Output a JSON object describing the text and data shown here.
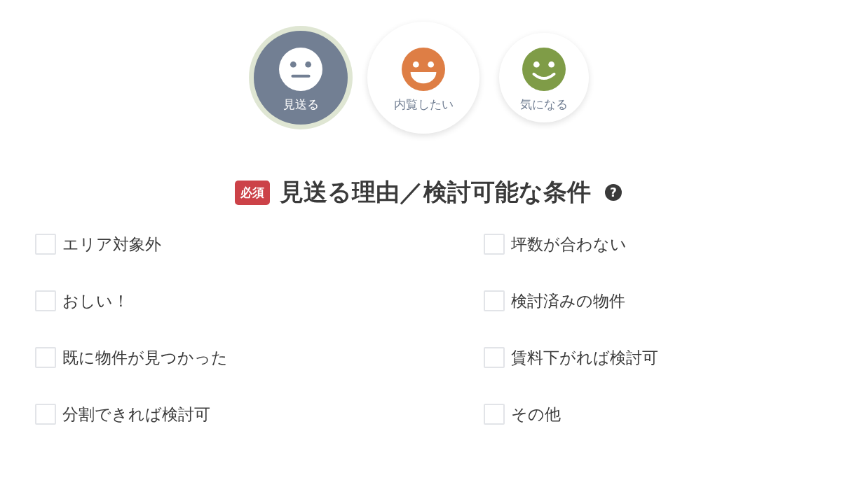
{
  "reactions": [
    {
      "kind": "neutral",
      "label": "見送る",
      "selected": true,
      "color": "#727f93"
    },
    {
      "kind": "grin",
      "label": "内覧したい",
      "selected": false,
      "color": "#de7e45"
    },
    {
      "kind": "smile",
      "label": "気になる",
      "selected": false,
      "color": "#7f9c47"
    }
  ],
  "section": {
    "badge": "必須",
    "title": "見送る理由／検討可能な条件",
    "help": "?"
  },
  "options": [
    {
      "label": "エリア対象外",
      "checked": false
    },
    {
      "label": "坪数が合わない",
      "checked": false
    },
    {
      "label": "おしい！",
      "checked": false
    },
    {
      "label": "検討済みの物件",
      "checked": false
    },
    {
      "label": "既に物件が見つかった",
      "checked": false
    },
    {
      "label": "賃料下がれば検討可",
      "checked": false
    },
    {
      "label": "分割できれば検討可",
      "checked": false
    },
    {
      "label": "その他",
      "checked": false
    }
  ]
}
